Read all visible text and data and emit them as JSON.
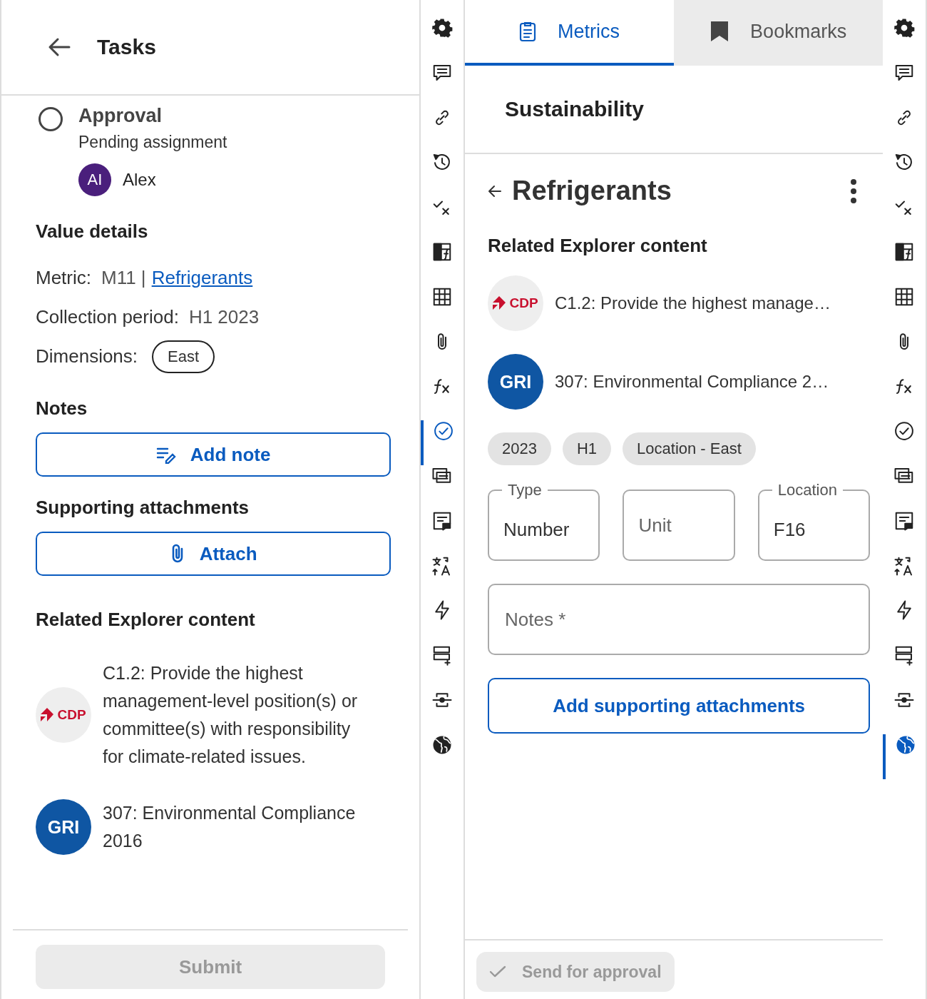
{
  "left_panel": {
    "header": {
      "title": "Tasks"
    },
    "task": {
      "title": "Approval",
      "checked": false,
      "status": "Pending assignment",
      "assignee": {
        "initials": "AI",
        "name": "Alex"
      }
    },
    "value_details": {
      "heading": "Value details",
      "fields": [
        {
          "kind": "link",
          "label": "Metric:",
          "value": "M11 |",
          "link": "Refrigerants"
        },
        {
          "kind": "text",
          "label": "Collection period:",
          "value": "H1 2023"
        },
        {
          "kind": "chip",
          "label": "Dimensions:",
          "value": "East"
        }
      ]
    },
    "notes": {
      "heading": "Notes",
      "button": "Add note"
    },
    "attachments": {
      "heading": "Supporting attachments",
      "button": "Attach"
    },
    "related": {
      "heading": "Related Explorer content",
      "items": [
        {
          "kind": "cdp",
          "logo": "CDP",
          "text": "C1.2: Provide the highest management-level position(s) or committee(s) with responsibility for climate-related issues."
        },
        {
          "kind": "gri",
          "logo": "GRI",
          "text": "307: Environmental Compliance 2016"
        }
      ]
    },
    "submit": {
      "label": "Submit",
      "disabled": true
    }
  },
  "left_rail": {
    "items": [
      {
        "kind": "gear",
        "selected": false
      },
      {
        "kind": "comment",
        "selected": false
      },
      {
        "kind": "link",
        "selected": false
      },
      {
        "kind": "history",
        "selected": false
      },
      {
        "kind": "check-x",
        "selected": false
      },
      {
        "kind": "table-fx",
        "selected": false
      },
      {
        "kind": "table",
        "selected": false
      },
      {
        "kind": "clip",
        "selected": false
      },
      {
        "kind": "fx",
        "selected": false
      },
      {
        "kind": "check-circle",
        "selected": true
      },
      {
        "kind": "cards",
        "selected": false
      },
      {
        "kind": "note",
        "selected": false
      },
      {
        "kind": "translate",
        "selected": false
      },
      {
        "kind": "bolt",
        "selected": false
      },
      {
        "kind": "rows-add",
        "selected": false
      },
      {
        "kind": "connector",
        "selected": false
      },
      {
        "kind": "globe",
        "selected": false
      }
    ]
  },
  "main_panel": {
    "tabs": [
      {
        "kind": "clipboard",
        "label": "Metrics",
        "selected": true
      },
      {
        "kind": "bookmark",
        "label": "Bookmarks",
        "selected": false
      }
    ],
    "section_title": "Sustainability",
    "title": "Refrigerants",
    "related": {
      "heading": "Related Explorer content",
      "items": [
        {
          "kind": "cdp",
          "logo": "CDP",
          "text": "C1.2: Provide the highest manage…"
        },
        {
          "kind": "gri",
          "logo": "GRI",
          "text": "307: Environmental Compliance 2…"
        }
      ]
    },
    "chips": [
      "2023",
      "H1",
      "Location - East"
    ],
    "fields": [
      {
        "label": "Type",
        "value": "Number"
      },
      {
        "placeholder": "Unit"
      },
      {
        "label": "Location",
        "value": "F16"
      }
    ],
    "notes_field": {
      "placeholder": "Notes *"
    },
    "attach_button": "Add supporting attachments",
    "footer": {
      "label": "Send for approval",
      "disabled": true
    }
  },
  "right_rail": {
    "items": [
      {
        "kind": "gear",
        "selected": false
      },
      {
        "kind": "comment",
        "selected": false
      },
      {
        "kind": "link",
        "selected": false
      },
      {
        "kind": "history",
        "selected": false
      },
      {
        "kind": "check-x",
        "selected": false
      },
      {
        "kind": "table-fx",
        "selected": false
      },
      {
        "kind": "table",
        "selected": false
      },
      {
        "kind": "clip",
        "selected": false
      },
      {
        "kind": "fx",
        "selected": false
      },
      {
        "kind": "check-circle",
        "selected": false
      },
      {
        "kind": "cards",
        "selected": false
      },
      {
        "kind": "note",
        "selected": false
      },
      {
        "kind": "translate",
        "selected": false
      },
      {
        "kind": "bolt",
        "selected": false
      },
      {
        "kind": "rows-add",
        "selected": false
      },
      {
        "kind": "connector",
        "selected": false
      },
      {
        "kind": "globe",
        "selected": true
      }
    ]
  }
}
